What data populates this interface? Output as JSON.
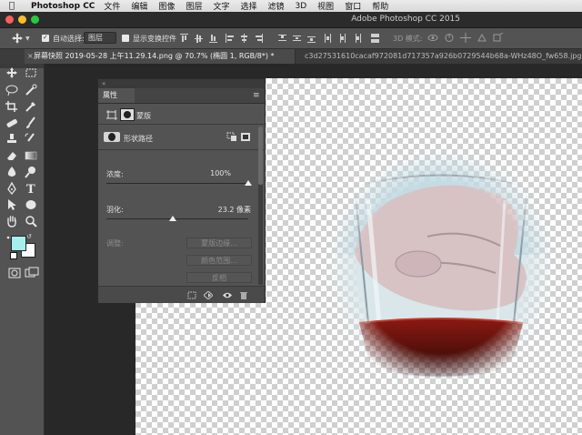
{
  "menubar": {
    "app_name": "Photoshop CC",
    "items": [
      "文件",
      "编辑",
      "图像",
      "图层",
      "文字",
      "选择",
      "滤镜",
      "3D",
      "视图",
      "窗口",
      "帮助"
    ]
  },
  "window": {
    "title": "Adobe Photoshop CC 2015"
  },
  "options_bar": {
    "auto_select_label": "自动选择:",
    "auto_select_value": "图层",
    "show_transform_label": "显示变换控件",
    "mode_3d_label": "3D 模式:"
  },
  "tabs": [
    {
      "label": "屏幕快照 2019-05-28 上午11.29.14.png @ 70.7% (椭圆 1, RGB/8*) *"
    },
    {
      "label": "c3d27531610cacaf972081d717357a926b0729544b68a-WHz48O_fw658.jpg @"
    }
  ],
  "properties_panel": {
    "tab_label": "属性",
    "mask_type_label": "蒙版",
    "vector_mask_label": "形状路径",
    "density_label": "浓度:",
    "density_value": "100%",
    "density_fraction": 1.0,
    "feather_label": "羽化:",
    "feather_value": "23.2 像素",
    "feather_fraction": 0.47,
    "refine_label": "调整:",
    "mask_edge_button": "蒙版边缘...",
    "color_range_button": "颜色范围...",
    "invert_button": "反相"
  },
  "colors": {
    "foreground": "#a5f0ee",
    "background": "#ffffff"
  }
}
